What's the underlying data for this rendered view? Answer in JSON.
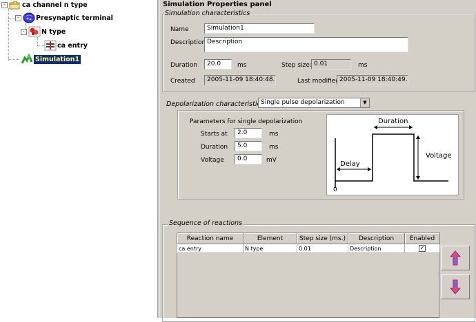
{
  "tree": {
    "items": [
      {
        "label": "ca channel n type",
        "icon": "folder-icon",
        "toggle": "-"
      },
      {
        "label": "Presynaptic terminal",
        "icon": "terminal-icon",
        "toggle": "-"
      },
      {
        "label": "N type",
        "icon": "channel-icon",
        "toggle": "-"
      },
      {
        "label": "ca entry",
        "icon": "reaction-icon",
        "toggle": ""
      },
      {
        "label": "Simulation1",
        "icon": "simulation-icon",
        "toggle": "",
        "selected": true
      }
    ]
  },
  "panel": {
    "title": "Simulation Properties panel",
    "sim": {
      "group_title": "Simulation characteristics",
      "name_label": "Name",
      "name_value": "Simulation1",
      "description_label": "Description",
      "description_value": "Description",
      "duration_label": "Duration",
      "duration_value": "20.0",
      "duration_unit": "ms",
      "step_label": "Step size:",
      "step_value": "0.01",
      "step_unit": "ms",
      "created_label": "Created",
      "created_value": "2005-11-09 18:40:48.0",
      "modified_label": "Last modified",
      "modified_value": "2005-11-09 18:40:49.0"
    },
    "depol": {
      "label": "Depolarization characteristics",
      "selected": "Single pulse depolarization",
      "params_title": "Parameters for single depolarization",
      "starts_label": "Starts at",
      "starts_value": "2.0",
      "starts_unit": "ms",
      "duration_label": "Duration",
      "duration_value": "5.0",
      "duration_unit": "ms",
      "voltage_label": "Voltage",
      "voltage_value": "0.0",
      "voltage_unit": "mV",
      "diagram": {
        "duration": "Duration",
        "voltage": "Voltage",
        "delay": "Delay",
        "zero": "0"
      }
    },
    "reactions": {
      "group_title": "Sequence of reactions",
      "columns": [
        "Reaction name",
        "Element",
        "Step size (ms.)",
        "Description",
        "Enabled"
      ],
      "rows": [
        {
          "name": "ca entry",
          "element": "N type",
          "step": "0.01",
          "description": "Description",
          "enabled": "✓"
        }
      ],
      "move_up_icon": "move-up-icon",
      "move_down_icon": "move-down-icon"
    }
  }
}
